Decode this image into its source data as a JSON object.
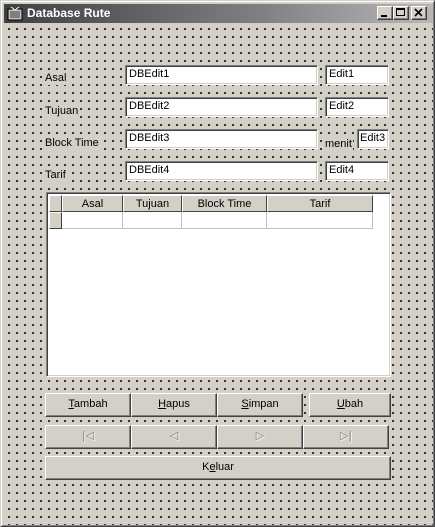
{
  "window": {
    "title": "Database Rute",
    "minimize_glyph": "_",
    "maximize_glyph": "□",
    "close_glyph": "×"
  },
  "form": {
    "asal_label": "Asal",
    "tujuan_label": "Tujuan",
    "block_time_label": "Block Time",
    "tarif_label": "Tarif",
    "menit_label": "menit",
    "dbedit1": "DBEdit1",
    "dbedit2": "DBEdit2",
    "dbedit3": "DBEdit3",
    "dbedit4": "DBEdit4",
    "edit1": "Edit1",
    "edit2": "Edit2",
    "edit3": "Edit3",
    "edit4": "Edit4"
  },
  "grid": {
    "columns": [
      "Asal",
      "Tujuan",
      "Block Time",
      "Tarif"
    ]
  },
  "buttons": {
    "tambah": {
      "mnemonic": "T",
      "rest": "ambah"
    },
    "hapus": {
      "mnemonic": "H",
      "rest": "apus"
    },
    "simpan": {
      "mnemonic": "S",
      "rest": "impan"
    },
    "ubah": {
      "mnemonic": "U",
      "rest": "bah"
    },
    "keluar": {
      "pre": "K",
      "mnemonic": "e",
      "rest": "luar"
    }
  },
  "navigator": {
    "first_glyph": "|◁",
    "prior_glyph": "◁",
    "next_glyph": "▷",
    "last_glyph": "▷|"
  },
  "colors": {
    "face": "#d4d0c8",
    "title_start": "#404040",
    "title_end": "#b8b8b8"
  }
}
